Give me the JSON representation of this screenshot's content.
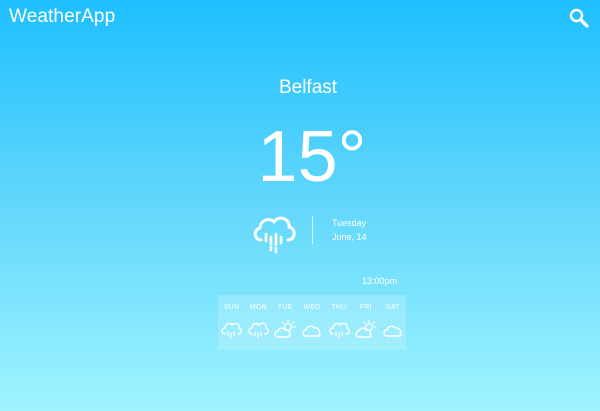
{
  "app": {
    "title": "WeatherApp"
  },
  "current": {
    "city": "Belfast",
    "temperature": "15°",
    "day": "Tuesday",
    "date": "June, 14",
    "icon": "rain-cloud-icon",
    "time": "13:00pm"
  },
  "forecast": [
    {
      "day": "SUN",
      "icon": "rain-icon"
    },
    {
      "day": "MON",
      "icon": "rain-icon"
    },
    {
      "day": "TUE",
      "icon": "partly-sunny-icon"
    },
    {
      "day": "WED",
      "icon": "cloud-icon"
    },
    {
      "day": "THU",
      "icon": "rain-icon"
    },
    {
      "day": "FRI",
      "icon": "partly-sunny-icon"
    },
    {
      "day": "SAT",
      "icon": "cloud-icon"
    }
  ],
  "colors": {
    "gradient_top": "#1ebfff",
    "gradient_bottom": "#9ff4ff",
    "text": "#ffffff"
  }
}
